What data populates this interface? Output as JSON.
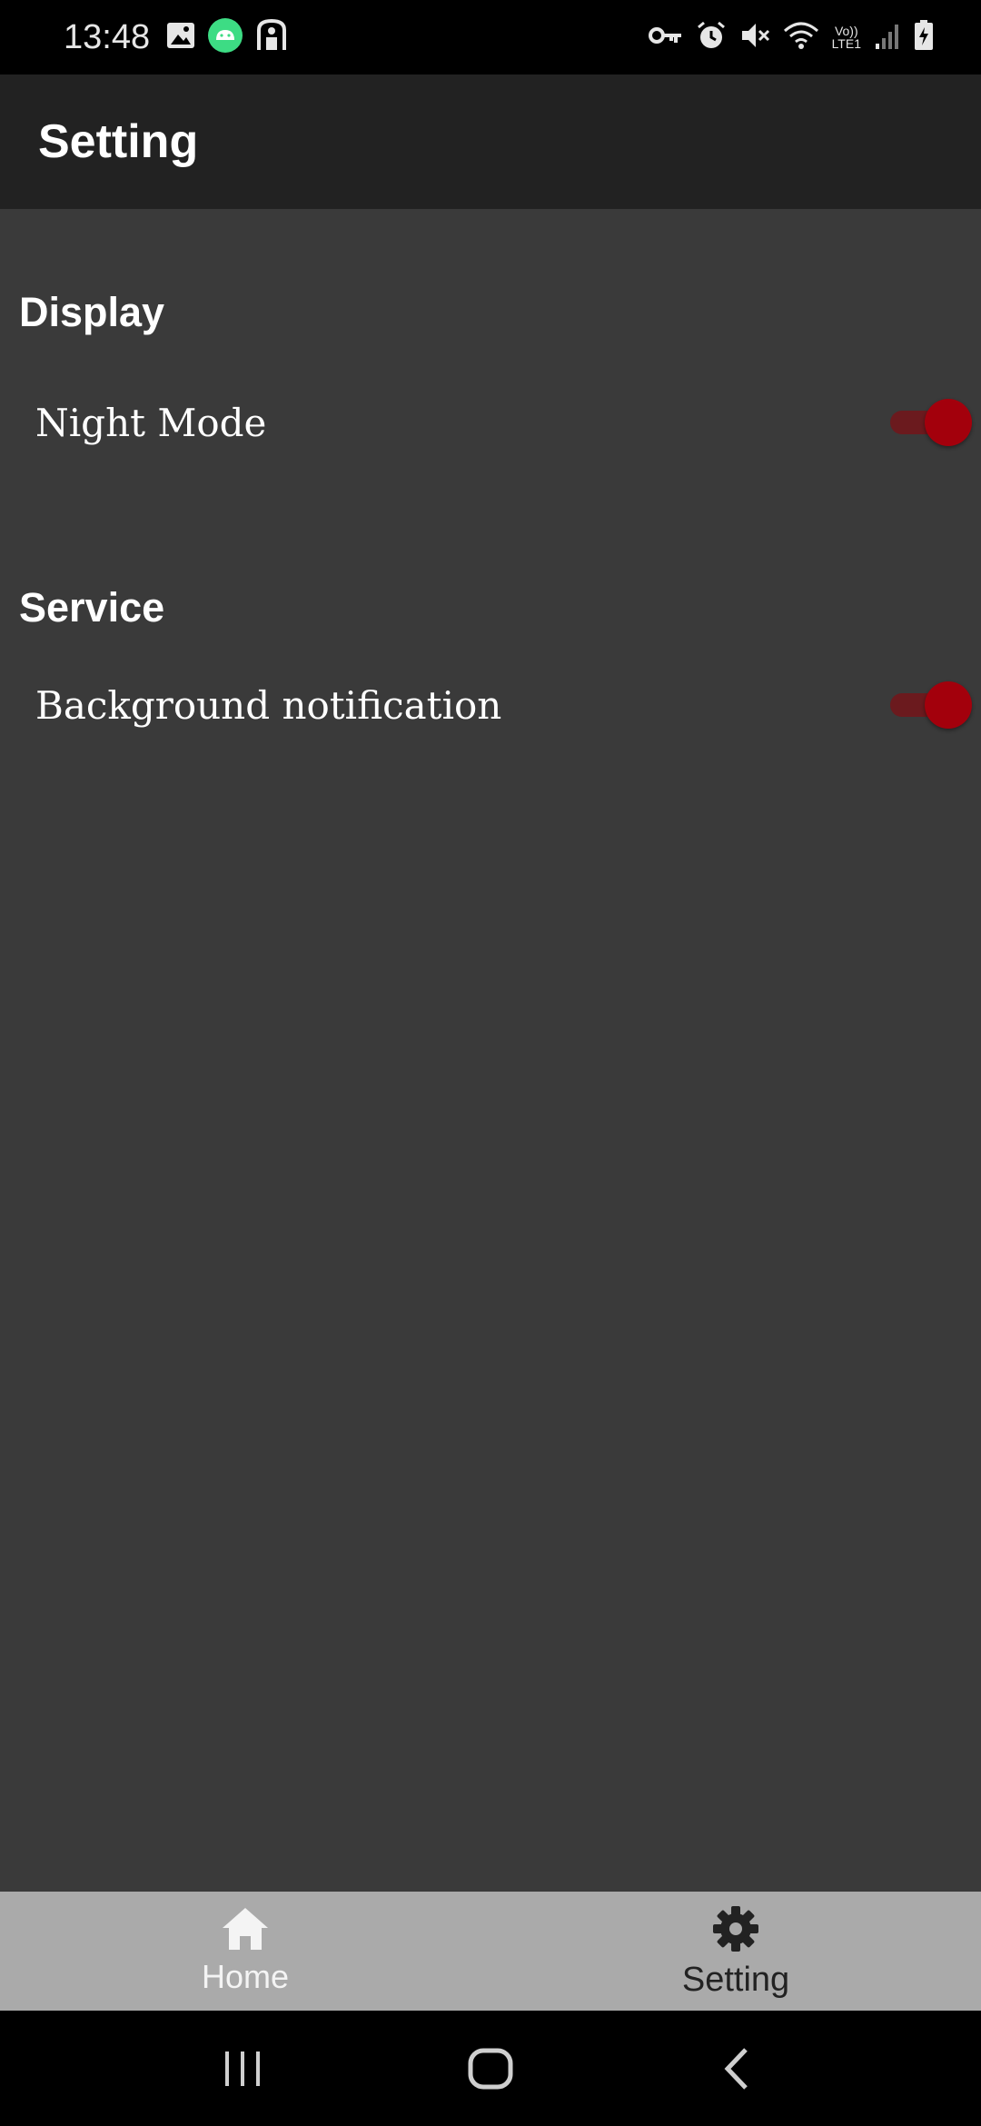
{
  "status_bar": {
    "time": "13:48",
    "left_icons": [
      "image-icon",
      "android-icon",
      "accessibility-icon"
    ],
    "right_icons": [
      "vpn-key-icon",
      "alarm-icon",
      "mute-icon",
      "wifi-icon",
      "volte-icon",
      "signal-icon",
      "battery-charging-icon"
    ],
    "volte_line1": "Vo))",
    "volte_line2": "LTE1"
  },
  "app_bar": {
    "title": "Setting"
  },
  "sections": [
    {
      "header": "Display",
      "items": [
        {
          "label": "Night Mode",
          "enabled": true
        }
      ]
    },
    {
      "header": "Service",
      "items": [
        {
          "label": "Background notification",
          "enabled": true
        }
      ]
    }
  ],
  "bottom_nav": {
    "items": [
      {
        "label": "Home",
        "icon": "home-icon",
        "active": false
      },
      {
        "label": "Setting",
        "icon": "gear-icon",
        "active": true
      }
    ]
  },
  "colors": {
    "background": "#3a3a3a",
    "app_bar": "#222222",
    "switch_accent": "#a3000c",
    "bottom_nav": "#aaaaaa"
  }
}
